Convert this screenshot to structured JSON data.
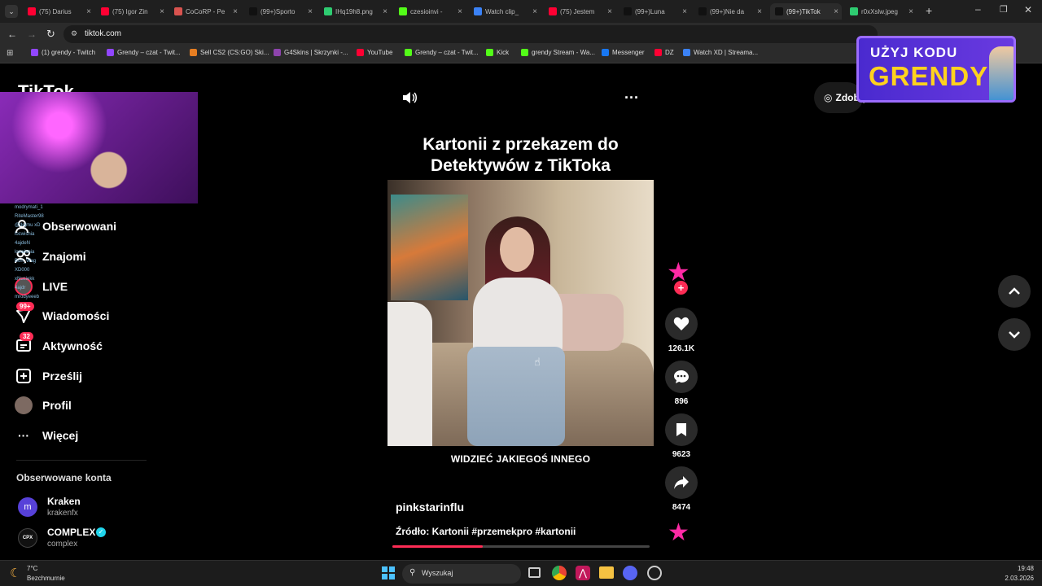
{
  "browser": {
    "tabs": [
      {
        "title": "(75) Darius",
        "color": "#ff0033"
      },
      {
        "title": "(75) Igor Zin",
        "color": "#ff0033"
      },
      {
        "title": "CoCoRP - Pe",
        "color": "#d9534f"
      },
      {
        "title": "(99+)Sporto",
        "color": "#111111"
      },
      {
        "title": "IHq19h8.png",
        "color": "#2ecc71"
      },
      {
        "title": "czesioinvi - ",
        "color": "#53fc18"
      },
      {
        "title": "Watch clip_",
        "color": "#3b82f6"
      },
      {
        "title": "(75) Jestem",
        "color": "#ff0033"
      },
      {
        "title": "(99+)Luna",
        "color": "#111111"
      },
      {
        "title": "(99+)Nie da",
        "color": "#111111"
      },
      {
        "title": "(99+)TikTok",
        "color": "#111111"
      },
      {
        "title": "r0xXslw.jpeg",
        "color": "#2ecc71"
      }
    ],
    "url": "tiktok.com",
    "bookmarks": [
      {
        "label": "(1) grendy - Twitch",
        "color": "#9146ff"
      },
      {
        "label": "Grendy – czat - Twit...",
        "color": "#9146ff"
      },
      {
        "label": "Sell CS2 (CS:GO) Ski...",
        "color": "#e67e22"
      },
      {
        "label": "G4Skins | Skrzynki -...",
        "color": "#8e44ad"
      },
      {
        "label": "YouTube",
        "color": "#ff0033"
      },
      {
        "label": "Grendy – czat - Twit...",
        "color": "#53fc18"
      },
      {
        "label": "Kick",
        "color": "#53fc18"
      },
      {
        "label": "grendy Stream - Wa...",
        "color": "#53fc18"
      },
      {
        "label": "Messenger",
        "color": "#1877f2"
      },
      {
        "label": "DZ",
        "color": "#ff0033"
      },
      {
        "label": "Watch XD | Streama...",
        "color": "#3b82f6"
      }
    ]
  },
  "overlay": {
    "promo_line1": "UŻYJ KODU",
    "promo_line2": "GRENDY",
    "chat_names": [
      "modrymati_1",
      "RiteMaster98",
      "@dejmu xD",
      "locwisnia",
      "4ajdeN",
      "locwisnia",
      "Bon_Wag",
      "XD000",
      "xNusiekk",
      "4ajdr",
      "mrodyeeeb"
    ]
  },
  "sidebar": {
    "logo": "TikTok",
    "items": [
      {
        "label": "Obserwowani",
        "icon": "following-icon"
      },
      {
        "label": "Znajomi",
        "icon": "friends-icon"
      },
      {
        "label": "LIVE",
        "icon": "live-icon"
      },
      {
        "label": "Wiadomości",
        "icon": "messages-icon",
        "badge": "99+"
      },
      {
        "label": "Aktywność",
        "icon": "activity-icon",
        "badge": "32"
      },
      {
        "label": "Prześlij",
        "icon": "upload-icon"
      },
      {
        "label": "Profil",
        "icon": "profile-icon"
      },
      {
        "label": "Więcej",
        "icon": "more-icon"
      }
    ],
    "following_header": "Obserwowane konta",
    "accounts": [
      {
        "name": "Kraken",
        "handle": "krakenfx",
        "verified": false
      },
      {
        "name": "COMPLEX",
        "handle": "complex",
        "verified": true
      }
    ]
  },
  "header": {
    "get_coins": "Zdobądź"
  },
  "post": {
    "title_line1": "Kartonii z przekazem do",
    "title_line2": "Detektywów z TikToka",
    "subtitle": "WIDZIEĆ JAKIEGOŚ INNEGO",
    "author": "pinkstarinflu",
    "description": "Źródło: Kartonii #przemekpro #kartonii",
    "progress": 0.35,
    "likes": "126.1K",
    "comments": "896",
    "saves": "9623",
    "shares": "8474"
  },
  "taskbar": {
    "weather_temp": "7°C",
    "weather_desc": "Bezchmurnie",
    "search_placeholder": "Wyszukaj",
    "time": "19:48",
    "date": "2.03.2026"
  },
  "colors": {
    "accent": "#fe2c55",
    "bg": "#000000"
  }
}
